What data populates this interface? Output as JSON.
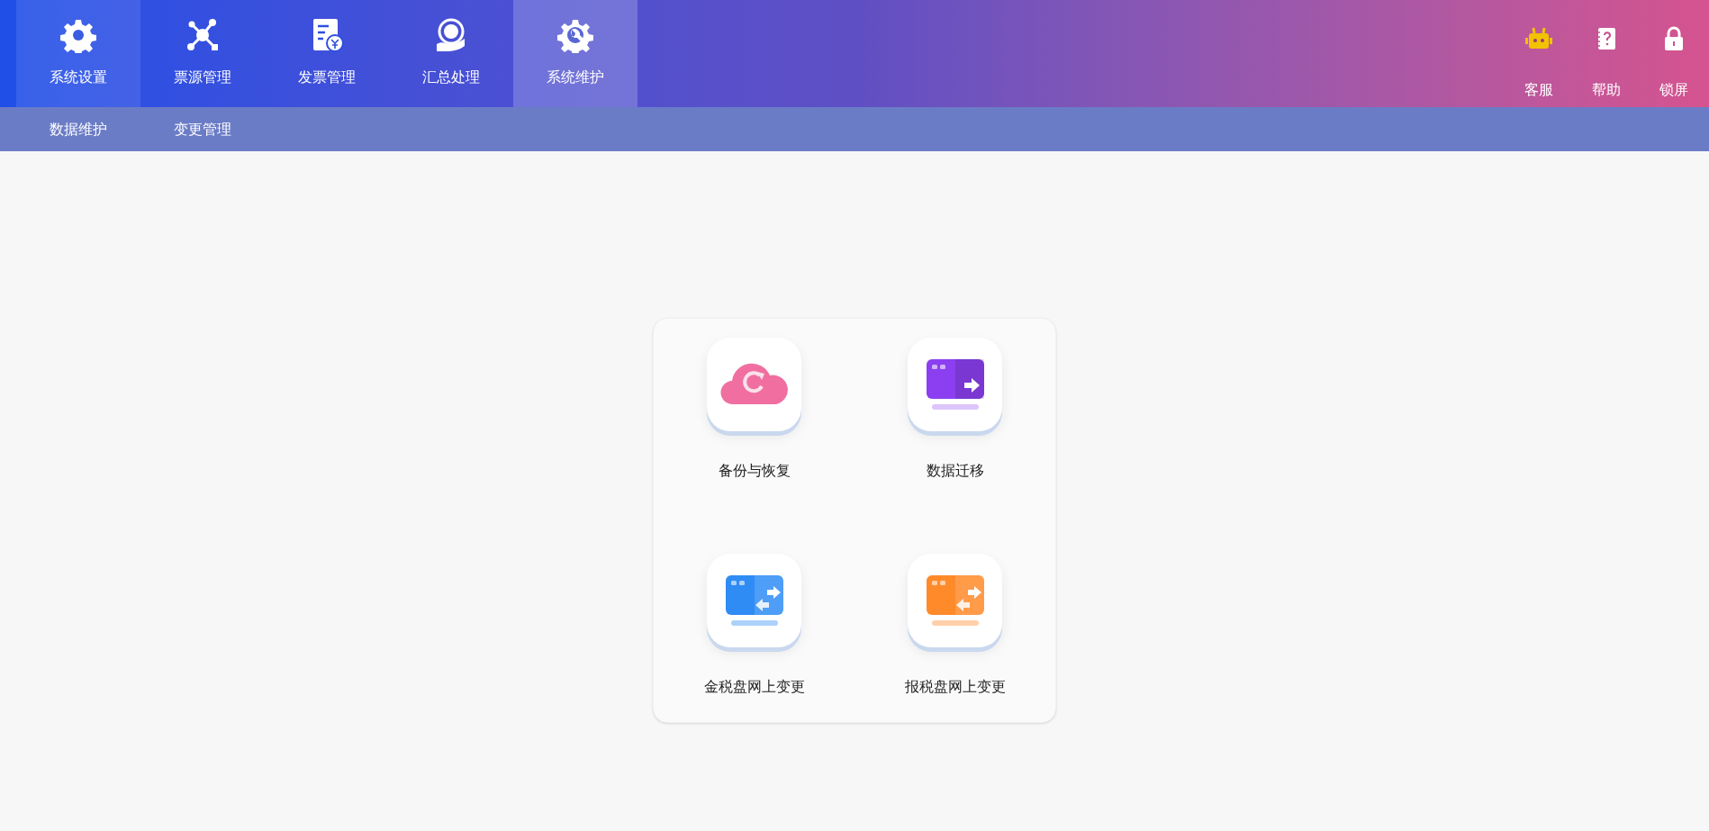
{
  "main_nav": [
    {
      "label": "系统设置",
      "selected": false,
      "hovered": true
    },
    {
      "label": "票源管理",
      "selected": false,
      "hovered": false
    },
    {
      "label": "发票管理",
      "selected": false,
      "hovered": false
    },
    {
      "label": "汇总处理",
      "selected": false,
      "hovered": false
    },
    {
      "label": "系统维护",
      "selected": true,
      "hovered": false
    }
  ],
  "tools": [
    {
      "label": "客服"
    },
    {
      "label": "帮助"
    },
    {
      "label": "锁屏"
    }
  ],
  "sub_nav": [
    {
      "label": "数据维护"
    },
    {
      "label": "变更管理"
    }
  ],
  "functions": [
    {
      "label": "备份与恢复",
      "kind": "cloud"
    },
    {
      "label": "数据迁移",
      "kind": "migrate",
      "color": "#8b3ff0"
    },
    {
      "label": "金税盘网上变更",
      "kind": "exchange",
      "color": "#2f8cf5"
    },
    {
      "label": "报税盘网上变更",
      "kind": "exchange",
      "color": "#ff8a2a"
    }
  ]
}
